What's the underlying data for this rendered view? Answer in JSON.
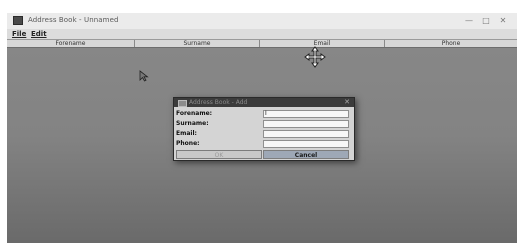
{
  "window": {
    "title": "Address Book - Unnamed",
    "minimize": "—",
    "maximize": "□",
    "close": "✕"
  },
  "menu": [
    "File",
    "Edit"
  ],
  "table": {
    "columns": [
      "Forename",
      "Surname",
      "Email",
      "Phone"
    ]
  },
  "dialog": {
    "title": "Address Book - Add",
    "close": "✕",
    "fields": [
      {
        "label": "Forename:",
        "value": "I"
      },
      {
        "label": "Surname:",
        "value": ""
      },
      {
        "label": "Email:",
        "value": ""
      },
      {
        "label": "Phone:",
        "value": ""
      }
    ],
    "ok_label": "OK",
    "cancel_label": "Cancel"
  }
}
